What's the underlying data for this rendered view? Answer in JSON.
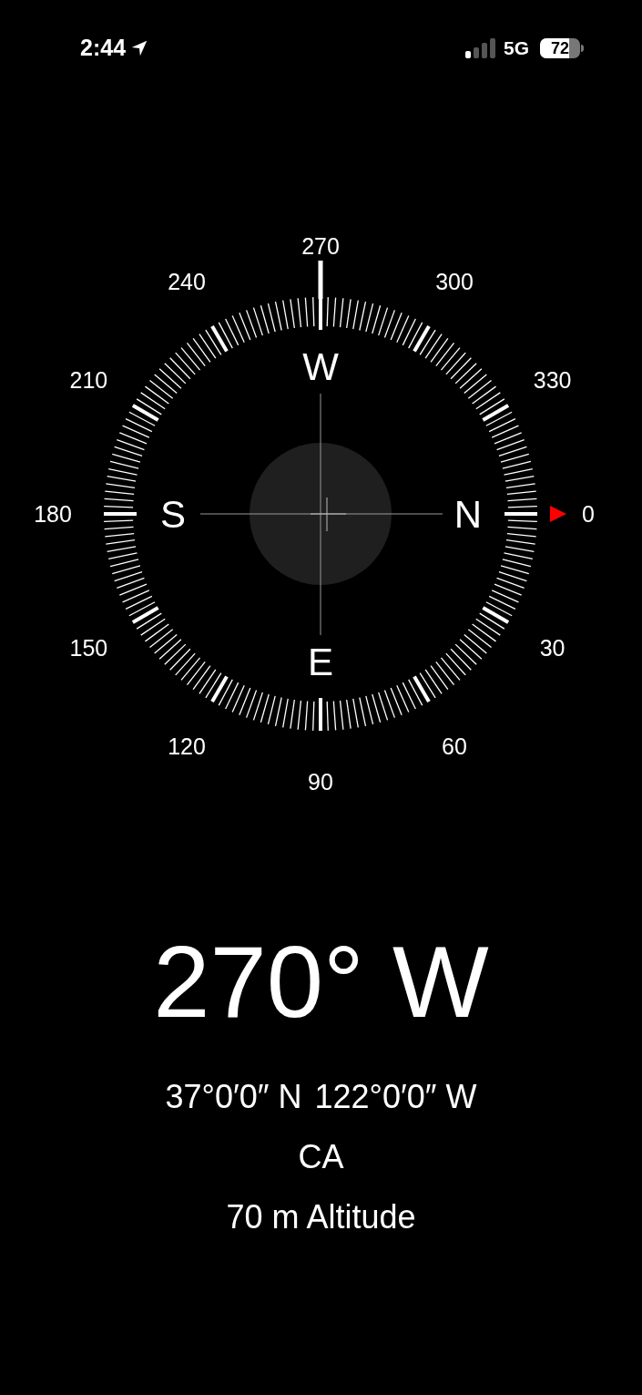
{
  "status_bar": {
    "time": "2:44",
    "network": "5G",
    "battery": "72"
  },
  "dial": {
    "degree_labels": [
      "0",
      "30",
      "60",
      "90",
      "120",
      "150",
      "180",
      "210",
      "240",
      "270",
      "300",
      "330"
    ],
    "cardinals": [
      "N",
      "E",
      "S",
      "W"
    ]
  },
  "heading": "270° W",
  "coordinates": [
    "37°0′0″ N",
    "122°0′0″ W"
  ],
  "place": "CA",
  "altitude": "70 m Altitude"
}
